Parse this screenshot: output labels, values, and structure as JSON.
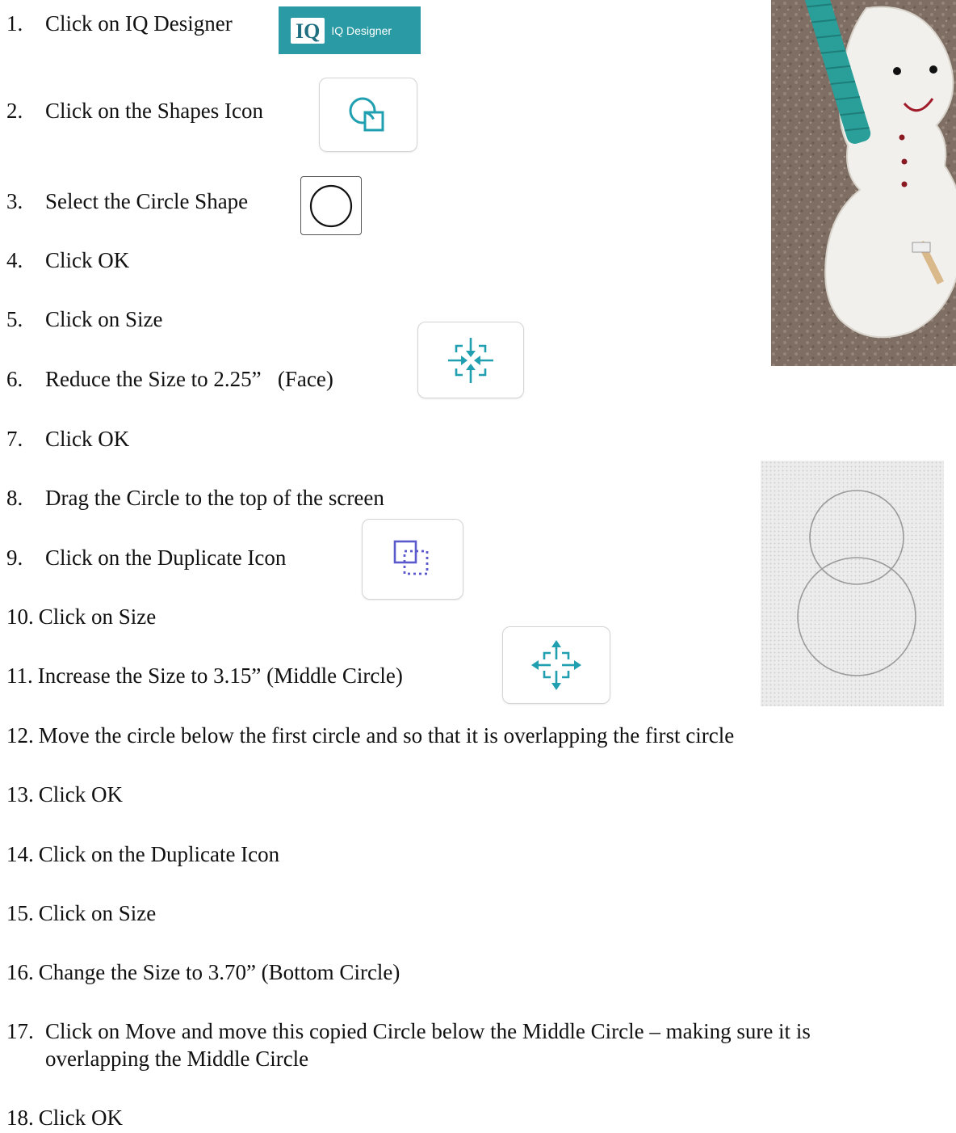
{
  "steps": [
    {
      "num": "1.",
      "text": "Click on IQ Designer"
    },
    {
      "num": "2.",
      "text": "Click on the Shapes Icon"
    },
    {
      "num": "3.",
      "text": "Select the Circle Shape"
    },
    {
      "num": "4.",
      "text": "Click OK"
    },
    {
      "num": "5.",
      "text": "Click on Size"
    },
    {
      "num": "6.",
      "text": "Reduce the Size to 2.25”   (Face)"
    },
    {
      "num": "7.",
      "text": "Click OK"
    },
    {
      "num": "8.",
      "text": "Drag the Circle to the top of the screen"
    },
    {
      "num": "9.",
      "text": "Click on the Duplicate Icon"
    },
    {
      "num": "10.",
      "text": "Click on Size"
    },
    {
      "num": "11.",
      "text": "Increase the Size to 3.15” (Middle Circle)"
    },
    {
      "num": "12.",
      "text": "Move the circle below the first circle and so that it is overlapping the first circle"
    },
    {
      "num": "13.",
      "text": "Click OK"
    },
    {
      "num": "14.",
      "text": "Click on the Duplicate Icon"
    },
    {
      "num": "15.",
      "text": "Click on Size"
    },
    {
      "num": "16.",
      "text": "Change the Size to 3.70” (Bottom Circle)"
    },
    {
      "num": "17.",
      "text": "Click on Move and move this copied Circle below the Middle Circle – making sure it is",
      "text_line2": "overlapping the Middle Circle"
    },
    {
      "num": "18.",
      "text": "Click OK"
    }
  ],
  "iq_button": {
    "mark": "IQ",
    "label": "IQ Designer"
  },
  "icons": {
    "shapes": "shapes-icon",
    "circle": "circle-shape-icon",
    "reduce_size": "reduce-size-icon",
    "duplicate": "duplicate-icon",
    "increase_size": "increase-size-icon"
  },
  "colors": {
    "teal": "#2a9aa4",
    "icon_teal": "#1f9fb0",
    "duplicate_blue": "#5a5acd"
  }
}
